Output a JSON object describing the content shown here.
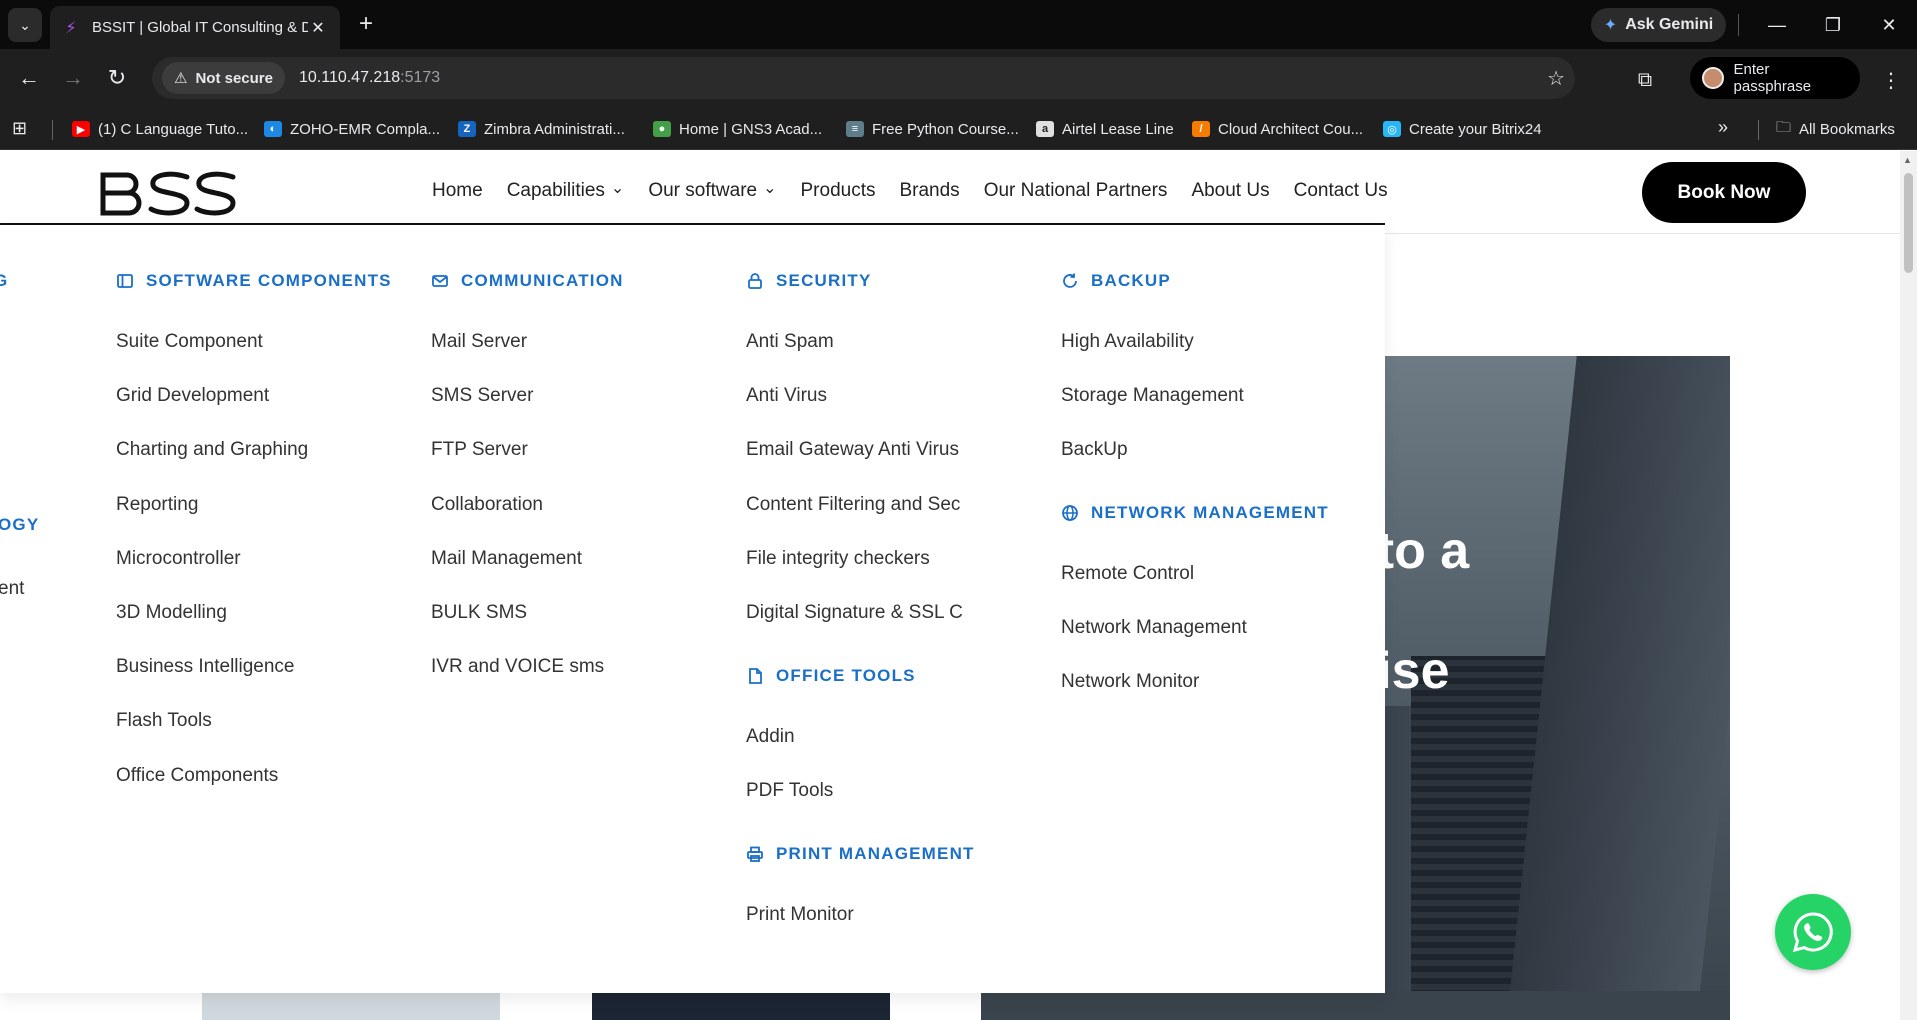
{
  "browser": {
    "tab_title": "BSSIT | Global IT Consulting & D",
    "gemini_label": "Ask Gemini",
    "security_chip": "Not secure",
    "url_host": "10.110.47.218",
    "url_port": ":5173",
    "profile_label": "Enter passphrase",
    "bookmarks": [
      {
        "label": "(1) C Language Tuto...",
        "color": "#ff0000",
        "glyph": "▶"
      },
      {
        "label": "ZOHO-EMR Compla...",
        "color": "#1e88e5",
        "glyph": "◐"
      },
      {
        "label": "Zimbra Administrati...",
        "color": "#1565c0",
        "glyph": "Z"
      },
      {
        "label": "Home | GNS3 Acad...",
        "color": "#43a047",
        "glyph": "●"
      },
      {
        "label": "Free Python Course...",
        "color": "#607d8b",
        "glyph": "≡"
      },
      {
        "label": "Airtel Lease Line",
        "color": "#e0e0e0",
        "glyph": "a"
      },
      {
        "label": "Cloud Architect Cou...",
        "color": "#f57c00",
        "glyph": "/"
      },
      {
        "label": "Create your Bitrix24",
        "color": "#29b6f6",
        "glyph": "◎"
      }
    ],
    "all_bookmarks": "All Bookmarks"
  },
  "site": {
    "nav": [
      {
        "label": "Home",
        "dropdown": false
      },
      {
        "label": "Capabilities",
        "dropdown": true
      },
      {
        "label": "Our software",
        "dropdown": true
      },
      {
        "label": "Products",
        "dropdown": false
      },
      {
        "label": "Brands",
        "dropdown": false
      },
      {
        "label": "Our National Partners",
        "dropdown": false
      },
      {
        "label": "About Us",
        "dropdown": false
      },
      {
        "label": "Contact Us",
        "dropdown": false
      }
    ],
    "book_now": "Book Now",
    "hero_line1": "nto a",
    "hero_line2": "rprise"
  },
  "mega": {
    "cut_left": {
      "head1": "G",
      "head2": "OGY",
      "item": "ent"
    },
    "software_components": {
      "title": "SOFTWARE COMPONENTS",
      "items": [
        "Suite Component",
        "Grid Development",
        "Charting and Graphing",
        "Reporting",
        "Microcontroller",
        "3D Modelling",
        "Business Intelligence",
        "Flash Tools",
        "Office Components"
      ]
    },
    "communication": {
      "title": "COMMUNICATION",
      "items": [
        "Mail Server",
        "SMS Server",
        "FTP Server",
        "Collaboration",
        "Mail Management",
        "BULK SMS",
        "IVR and VOICE sms"
      ]
    },
    "security": {
      "title": "SECURITY",
      "items": [
        "Anti Spam",
        "Anti Virus",
        "Email Gateway Anti Virus",
        "Content Filtering and Sec",
        "File integrity checkers",
        "Digital Signature & SSL C"
      ]
    },
    "office_tools": {
      "title": "OFFICE TOOLS",
      "items": [
        "Addin",
        "PDF Tools"
      ]
    },
    "print_management": {
      "title": "PRINT MANAGEMENT",
      "items": [
        "Print Monitor"
      ]
    },
    "backup": {
      "title": "BACKUP",
      "items": [
        "High Availability",
        "Storage Management",
        "BackUp"
      ]
    },
    "network_management": {
      "title": "NETWORK MANAGEMENT",
      "items": [
        "Remote Control",
        "Network Management",
        "Network Monitor"
      ]
    }
  },
  "colors": {
    "accent": "#1a6fc9",
    "whatsapp": "#25d366"
  }
}
